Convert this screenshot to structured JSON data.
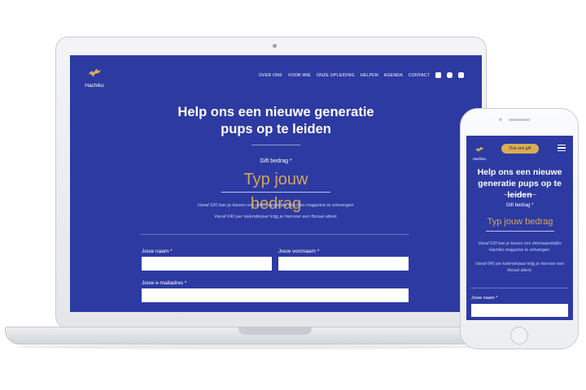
{
  "brand": {
    "name": "Hachiko",
    "accent": "#2d3aa2",
    "gold": "#d3a65a"
  },
  "desktop": {
    "nav": [
      "OVER ONS",
      "VOOR WIE",
      "ONZE OPLEIDING",
      "HELPEN",
      "AGENDA",
      "CONTACT"
    ],
    "social_icons": [
      "facebook-icon",
      "instagram-icon",
      "youtube-icon"
    ],
    "hero_title_line1": "Help ons een nieuwe generatie",
    "hero_title_line2": "pups op te leiden",
    "gift_label": "Gift bedrag *",
    "gift_placeholder": "Typ jouw bedrag",
    "note1": "Vanaf €20 kan je kiezen ons driemaandelijks Hachiko magazine te ontvangen.",
    "note2": "Vanaf €40 per kalenderjaar krijg je hiervoor een fiscaal attest.",
    "field_name": "Jouw naam *",
    "field_firstname": "Jouw voornaam *",
    "field_email": "Jouw e-mailadres *"
  },
  "mobile": {
    "donate_button": "Doe een gift",
    "hero_title_line1": "Help ons een nieuwe",
    "hero_title_line2": "generatie pups op te leiden",
    "gift_label": "Gift bedrag *",
    "gift_placeholder": "Typ jouw bedrag",
    "note1": "Vanaf €20 kan je kiezen ons driemaandelijks Hachiko magazine te ontvangen.",
    "note2": "Vanaf €40 per kalenderjaar krijg je hiervoor een fiscaal attest.",
    "field_name": "Jouw naam *"
  }
}
